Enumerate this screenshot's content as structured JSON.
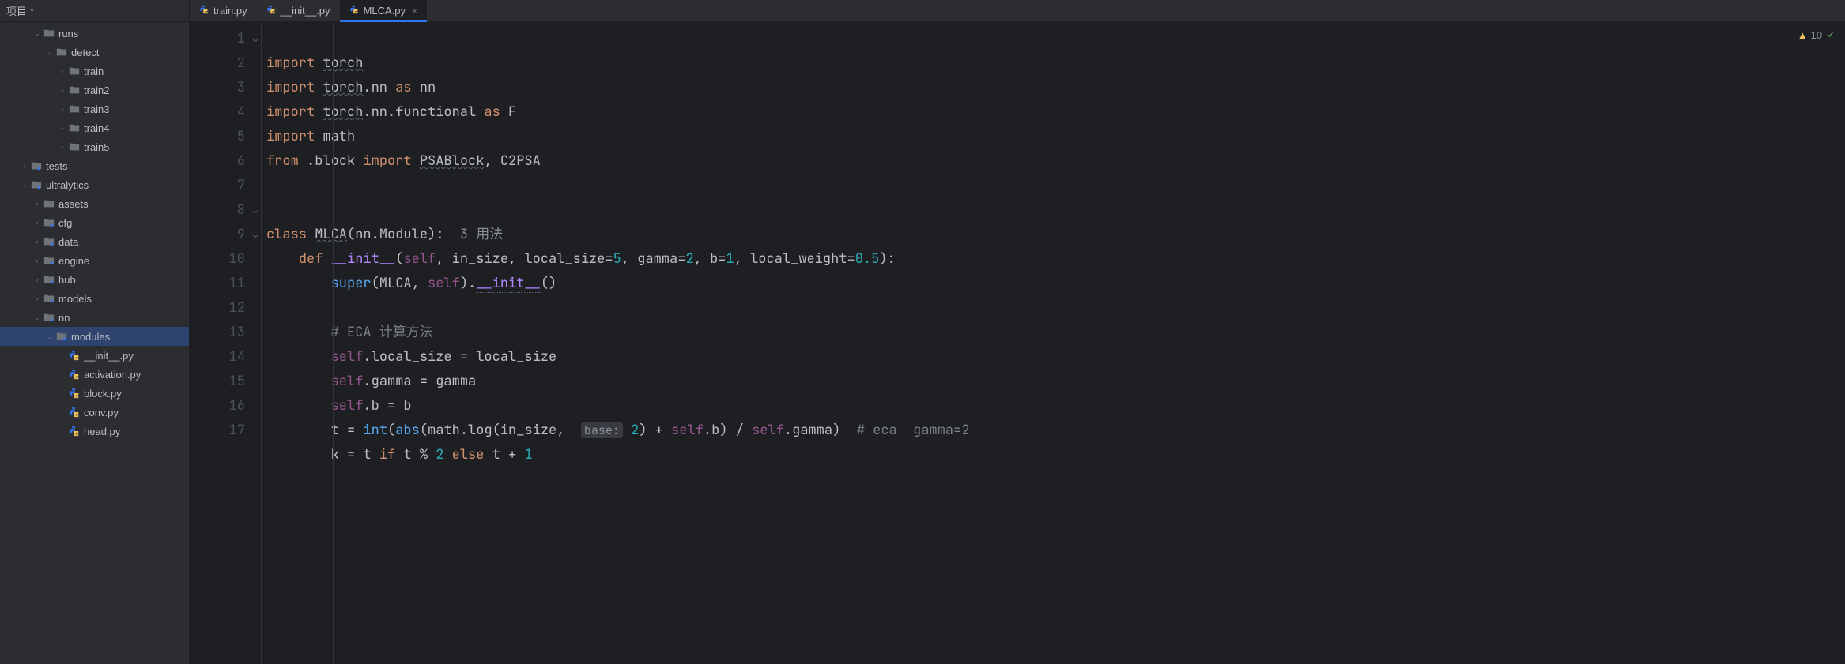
{
  "sidebar": {
    "title": "项目",
    "tree": [
      {
        "level": 1,
        "arrow": "v",
        "icon": "folder",
        "label": "runs"
      },
      {
        "level": 2,
        "arrow": "v",
        "icon": "folder",
        "label": "detect"
      },
      {
        "level": 3,
        "arrow": ">",
        "icon": "folder",
        "label": "train"
      },
      {
        "level": 3,
        "arrow": ">",
        "icon": "folder",
        "label": "train2"
      },
      {
        "level": 3,
        "arrow": ">",
        "icon": "folder",
        "label": "train3"
      },
      {
        "level": 3,
        "arrow": ">",
        "icon": "folder",
        "label": "train4"
      },
      {
        "level": 3,
        "arrow": ">",
        "icon": "folder",
        "label": "train5"
      },
      {
        "level": 0,
        "arrow": ">",
        "icon": "folder-dot",
        "label": "tests"
      },
      {
        "level": 0,
        "arrow": "v",
        "icon": "folder-dot",
        "label": "ultralytics"
      },
      {
        "level": 1,
        "arrow": ">",
        "icon": "folder",
        "label": "assets"
      },
      {
        "level": 1,
        "arrow": ">",
        "icon": "folder-dot",
        "label": "cfg"
      },
      {
        "level": 1,
        "arrow": ">",
        "icon": "folder-dot",
        "label": "data"
      },
      {
        "level": 1,
        "arrow": ">",
        "icon": "folder-dot",
        "label": "engine"
      },
      {
        "level": 1,
        "arrow": ">",
        "icon": "folder-dot",
        "label": "hub"
      },
      {
        "level": 1,
        "arrow": ">",
        "icon": "folder-dot",
        "label": "models"
      },
      {
        "level": 1,
        "arrow": "v",
        "icon": "folder-dot",
        "label": "nn"
      },
      {
        "level": 2,
        "arrow": "v",
        "icon": "folder-dot",
        "label": "modules",
        "selected": true
      },
      {
        "level": 3,
        "arrow": "",
        "icon": "py",
        "label": "__init__.py"
      },
      {
        "level": 3,
        "arrow": "",
        "icon": "py",
        "label": "activation.py"
      },
      {
        "level": 3,
        "arrow": "",
        "icon": "py",
        "label": "block.py"
      },
      {
        "level": 3,
        "arrow": "",
        "icon": "py",
        "label": "conv.py"
      },
      {
        "level": 3,
        "arrow": "",
        "icon": "py",
        "label": "head.py"
      }
    ]
  },
  "tabs": [
    {
      "label": "train.py",
      "active": false
    },
    {
      "label": "__init__.py",
      "active": false
    },
    {
      "label": "MLCA.py",
      "active": true
    }
  ],
  "status": {
    "warnings": "10"
  },
  "code": {
    "lines": [
      "1",
      "2",
      "3",
      "4",
      "5",
      "6",
      "7",
      "8",
      "9",
      "10",
      "11",
      "12",
      "13",
      "14",
      "15",
      "16",
      "17"
    ],
    "l1_import": "import",
    "l1_torch": "torch",
    "l2_import": "import",
    "l2_torch": "torch",
    "l2_nn": ".nn",
    "l2_as": "as",
    "l2_alias": "nn",
    "l3_import": "import",
    "l3_torch": "torch",
    "l3_rest": ".nn.functional",
    "l3_as": "as",
    "l3_alias": "F",
    "l4_import": "import",
    "l4_math": "math",
    "l5_from": "from",
    "l5_mod": ".block",
    "l5_import": "import",
    "l5_a": "PSABlock",
    "l5_comma": ", ",
    "l5_b": "C2PSA",
    "l8_class": "class",
    "l8_name": "MLCA",
    "l8_paren": "(nn.Module):",
    "l8_hint": "3 用法",
    "l9_def": "def",
    "l9_name": "__init__",
    "l9_open": "(",
    "l9_self": "self",
    "l9_rest": ", in_size, local_size=",
    "l9_v1": "5",
    "l9_c1": ", gamma=",
    "l9_v2": "2",
    "l9_c2": ", b=",
    "l9_v3": "1",
    "l9_c3": ", local_weight=",
    "l9_v4": "0.5",
    "l9_close": "):",
    "l10_super": "super",
    "l10_rest1": "(MLCA, ",
    "l10_self": "self",
    "l10_rest2": ").",
    "l10_init": "__init__",
    "l10_end": "()",
    "l12_comment": "# ECA 计算方法",
    "l13_self": "self",
    "l13_rest": ".local_size = local_size",
    "l14_self": "self",
    "l14_rest": ".gamma = gamma",
    "l15_self": "self",
    "l15_rest": ".b = b",
    "l16_t": "t = ",
    "l16_int": "int",
    "l16_open": "(",
    "l16_abs": "abs",
    "l16_rest1": "(math.log(in_size, ",
    "l16_hint": "base:",
    "l16_v1": "2",
    "l16_rest2": ") + ",
    "l16_self1": "self",
    "l16_rest3": ".b) / ",
    "l16_self2": "self",
    "l16_rest4": ".gamma)",
    "l16_comment": "  # eca  gamma=2",
    "l17_k": "k = t ",
    "l17_if": "if",
    "l17_mid": " t % ",
    "l17_v1": "2",
    "l17_else": "else",
    "l17_end": " t + ",
    "l17_v2": "1"
  }
}
